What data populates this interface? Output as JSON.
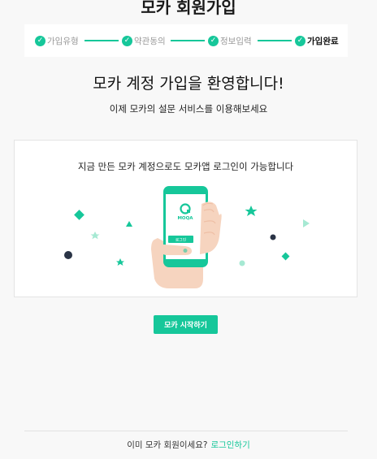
{
  "page": {
    "title": "모카 회원가입"
  },
  "stepper": {
    "steps": [
      {
        "label": "가입유형",
        "done": true
      },
      {
        "label": "약관동의",
        "done": true
      },
      {
        "label": "정보입력",
        "done": true
      },
      {
        "label": "가입완료",
        "done": true,
        "current": true
      }
    ]
  },
  "welcome": {
    "title": "모카 계정 가입을 환영합니다!",
    "subtitle": "이제 모카의 설문 서비스를 이용해보세요"
  },
  "card": {
    "message": "지금 만든 모카 계정으로도 모카앱 로그인이 가능합니다",
    "phone_logo_text": "MOQA",
    "phone_button_text": "로그인"
  },
  "actions": {
    "start_label": "모카 시작하기"
  },
  "footer": {
    "question": "이미 모카 회원이세요?",
    "login_link": "로그인하기"
  },
  "colors": {
    "accent": "#16c79a",
    "background": "#f8f8f8",
    "hand": "#f6d4bf"
  },
  "icons": [
    "check-icon",
    "moqa-logo-icon",
    "diamond-icon",
    "triangle-icon",
    "star-icon",
    "dot-icon"
  ]
}
